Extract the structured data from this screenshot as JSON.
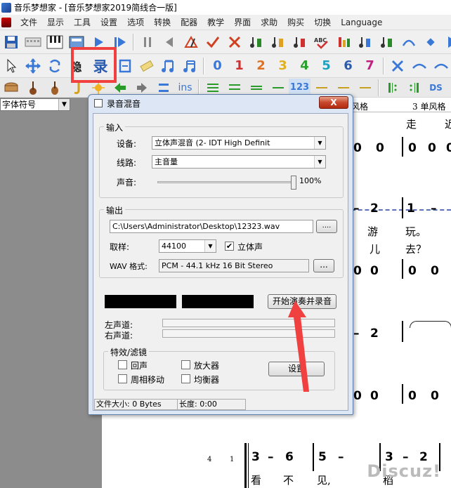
{
  "window": {
    "title": "音乐梦想家 - [音乐梦想家2019简线合一版]"
  },
  "menu": [
    "文件",
    "显示",
    "工具",
    "设置",
    "选项",
    "转换",
    "配器",
    "教学",
    "界面",
    "求助",
    "购买",
    "切换",
    "Language"
  ],
  "toolbar2": {
    "record_label": "录",
    "ins_label": "ins",
    "numbers": [
      "0",
      "1",
      "2",
      "3",
      "4",
      "5",
      "6",
      "7"
    ]
  },
  "toolbar3": {
    "num_label": "123",
    "ds_label": "DS"
  },
  "font_select": {
    "value": "字体符号"
  },
  "score": {
    "header_right_1": "风格",
    "header_right_2": "3 单风格",
    "notes": [
      "0",
      "0",
      "0",
      "0",
      "0",
      "2",
      "1",
      "–",
      "2",
      "0",
      "0",
      "0",
      "0",
      "0",
      "0",
      "3",
      "–",
      "6",
      "5",
      "–",
      "3",
      "–",
      "2"
    ],
    "lyrics": [
      "走",
      "游",
      "玩。",
      "儿",
      "去？",
      "看",
      "不",
      "见,",
      "稻"
    ],
    "measure_numbers": [
      "4",
      "1"
    ]
  },
  "watermark": "Discuz!",
  "dialog": {
    "title": "录音混音",
    "close_label": "X",
    "input_group": "输入",
    "device_label": "设备:",
    "device_value": "立体声混音 (2- IDT High Definit",
    "line_label": "线路:",
    "line_value": "主音量",
    "volume_label": "声音:",
    "volume_value": "100%",
    "volume_level": 1.0,
    "output_group": "输出",
    "path_value": "C:\\Users\\Administrator\\Desktop\\12323.wav",
    "browse_label": "....",
    "sample_label": "取样:",
    "sample_value": "44100",
    "stereo_label": "立体声",
    "stereo_checked": true,
    "wav_label": "WAV 格式:",
    "wav_value": "PCM - 44.1 kHz 16 Bit Stereo",
    "wav_more_label": "...",
    "start_button": "开始演奏并录音",
    "left_channel": "左声道:",
    "right_channel": "右声道:",
    "effects_group": "特效/滤镜",
    "echo_label": "回声",
    "amplifier_label": "放大器",
    "phase_label": "周相移动",
    "equalizer_label": "均衡器",
    "settings_button": "设置",
    "status_size": "文件大小: 0 Bytes",
    "status_length": "长度: 0:00"
  },
  "colors": {
    "highlight": "#f04040",
    "dialog_frame": "#dce6f4"
  }
}
